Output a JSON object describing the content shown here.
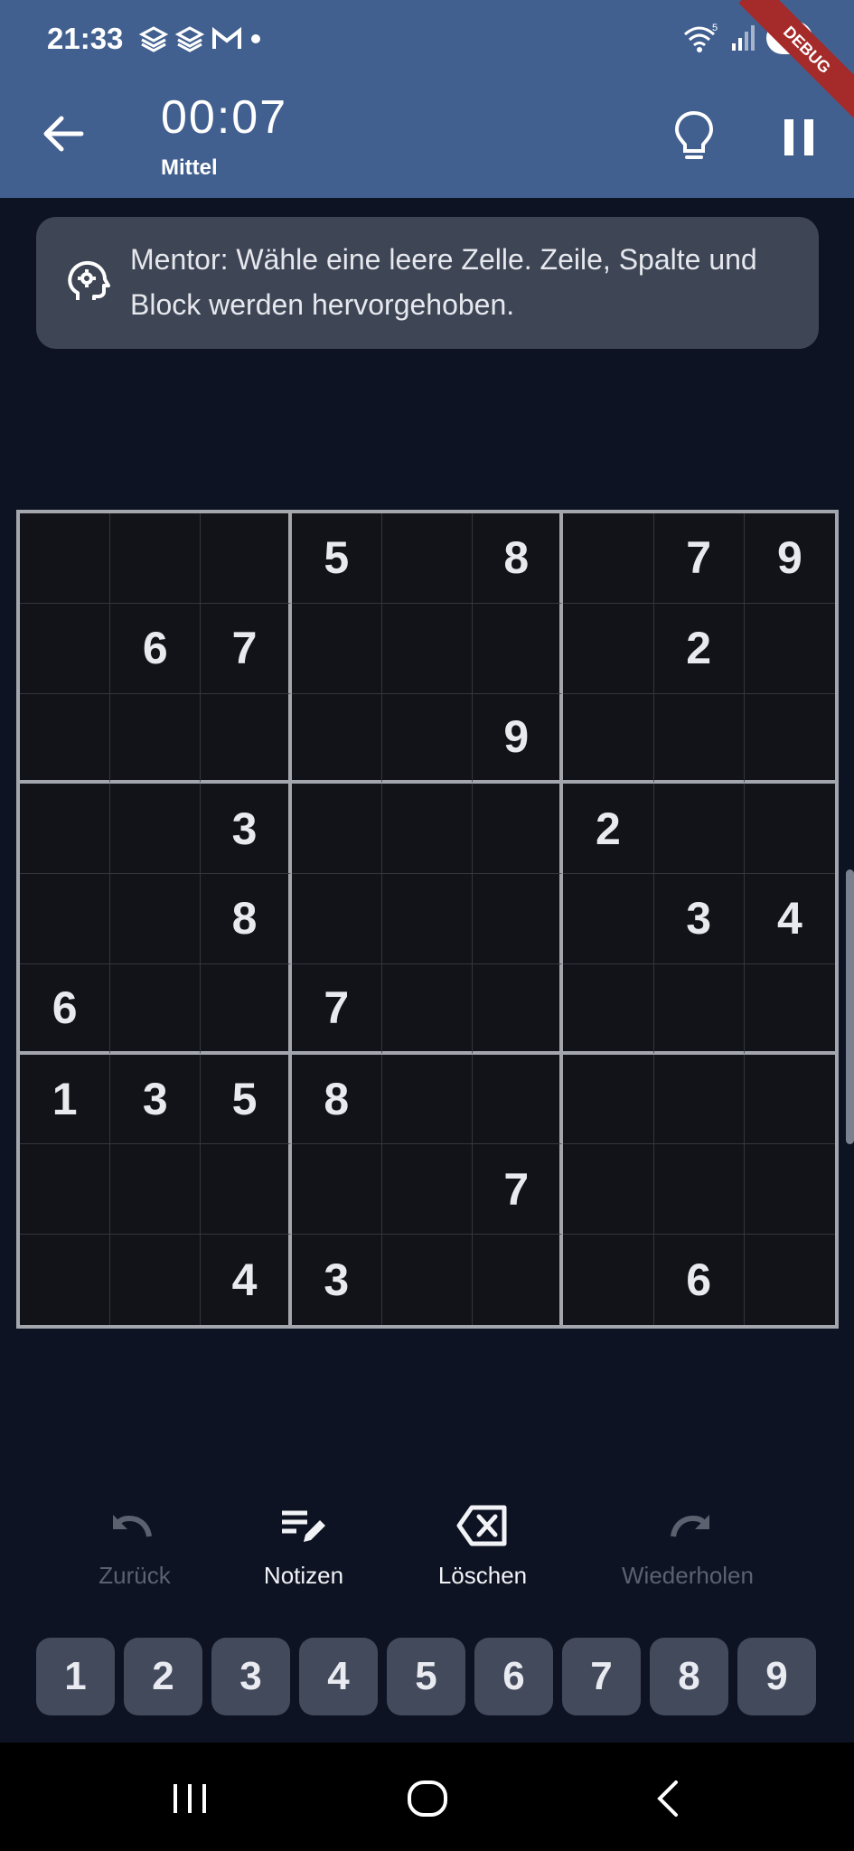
{
  "status_bar": {
    "time": "21:33",
    "network_badge": "5",
    "battery": "91",
    "debug_label": "DEBUG"
  },
  "app_bar": {
    "timer": "00:07",
    "difficulty": "Mittel",
    "icons": [
      "back-arrow-icon",
      "lightbulb-icon",
      "pause-icon"
    ]
  },
  "mentor": {
    "text": "Mentor: Wähle eine leere Zelle. Zeile, Spalte und Block werden hervorgehoben.",
    "icon": "mentor-head-icon"
  },
  "board": {
    "rows": [
      [
        "",
        "",
        "",
        "5",
        "",
        "8",
        "",
        "7",
        "9"
      ],
      [
        "",
        "6",
        "7",
        "",
        "",
        "",
        "",
        "2",
        ""
      ],
      [
        "",
        "",
        "",
        "",
        "",
        "9",
        "",
        "",
        ""
      ],
      [
        "",
        "",
        "3",
        "",
        "",
        "",
        "2",
        "",
        ""
      ],
      [
        "",
        "",
        "8",
        "",
        "",
        "",
        "",
        "3",
        "4"
      ],
      [
        "6",
        "",
        "",
        "7",
        "",
        "",
        "",
        "",
        ""
      ],
      [
        "1",
        "3",
        "5",
        "8",
        "",
        "",
        "",
        "",
        ""
      ],
      [
        "",
        "",
        "",
        "",
        "",
        "7",
        "",
        "",
        ""
      ],
      [
        "",
        "",
        "4",
        "3",
        "",
        "",
        "",
        "6",
        ""
      ]
    ]
  },
  "actions": [
    {
      "label": "Zurück",
      "icon": "undo-icon",
      "enabled": false
    },
    {
      "label": "Notizen",
      "icon": "notes-edit-icon",
      "enabled": true
    },
    {
      "label": "Löschen",
      "icon": "backspace-icon",
      "enabled": true
    },
    {
      "label": "Wiederholen",
      "icon": "redo-icon",
      "enabled": false
    }
  ],
  "numpad": [
    "1",
    "2",
    "3",
    "4",
    "5",
    "6",
    "7",
    "8",
    "9"
  ],
  "colors": {
    "app_bar": "#41608f",
    "background": "#0d1322",
    "card": "#3e4554",
    "board": "#121319",
    "key": "#434a5c",
    "disabled_text": "#5c6170"
  }
}
